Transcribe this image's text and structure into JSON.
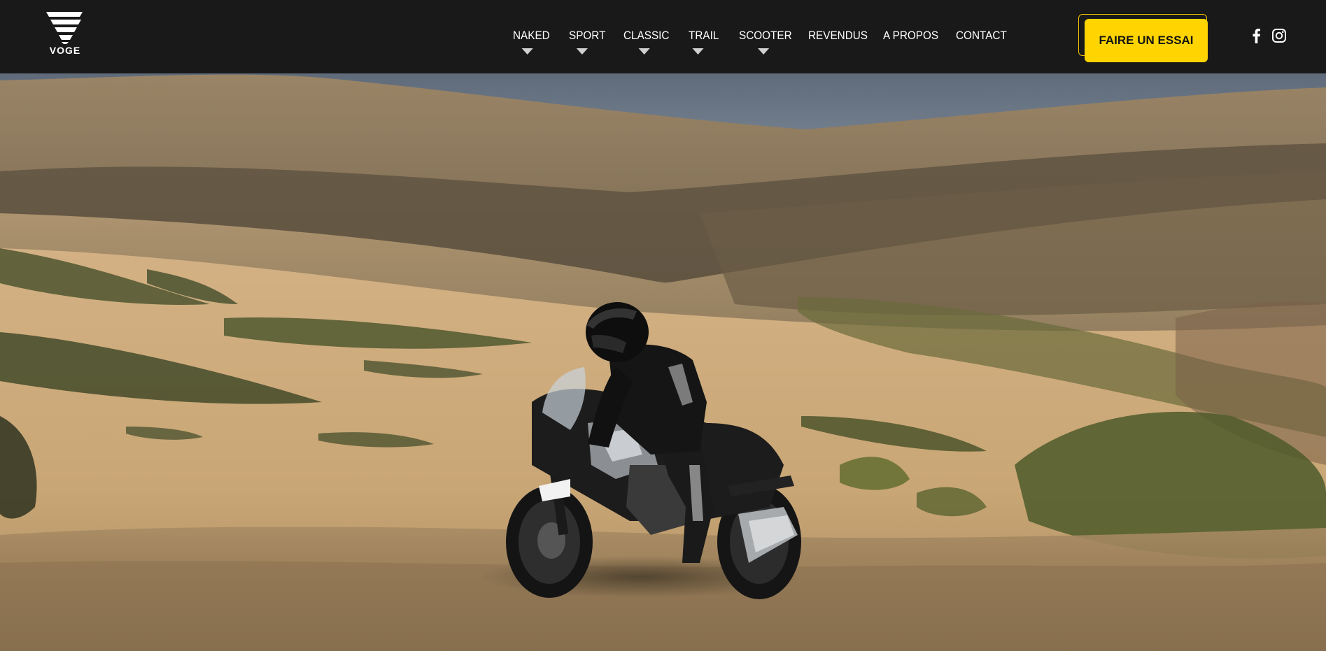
{
  "brand": {
    "name": "VOGE"
  },
  "nav": {
    "items": [
      {
        "label": "NAKED",
        "has_dropdown": true
      },
      {
        "label": "SPORT",
        "has_dropdown": true
      },
      {
        "label": "CLASSIC",
        "has_dropdown": true
      },
      {
        "label": "TRAIL",
        "has_dropdown": true
      },
      {
        "label": "SCOOTER",
        "has_dropdown": true
      },
      {
        "label": "REVENDUS",
        "has_dropdown": false
      },
      {
        "label": "A PROPOS",
        "has_dropdown": false
      },
      {
        "label": "CONTACT",
        "has_dropdown": false
      }
    ]
  },
  "cta": {
    "label": "FAIRE UN ESSAI"
  },
  "social": [
    {
      "icon": "facebook-icon"
    },
    {
      "icon": "instagram-icon"
    }
  ],
  "colors": {
    "header_bg": "#191919",
    "accent": "#ffd400",
    "nav_text": "#ffffff",
    "caret": "#d0d0d0"
  },
  "hero": {
    "image": "motorcycle-rider-offroad-hills-photo"
  }
}
